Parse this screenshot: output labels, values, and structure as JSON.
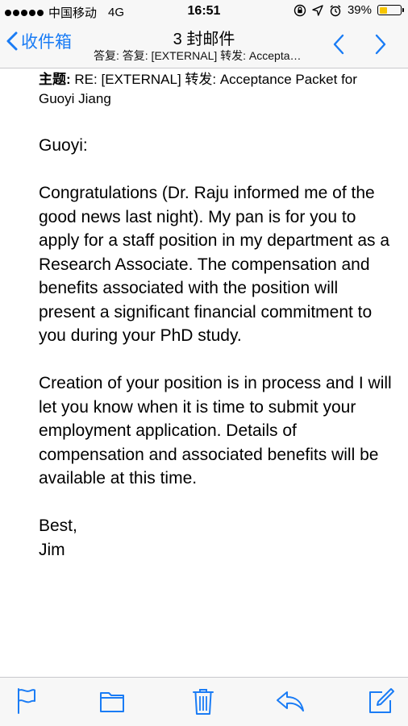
{
  "status_bar": {
    "carrier": "中国移动",
    "network": "4G",
    "time": "16:51",
    "battery_percent": "39%",
    "battery_level": 0.39,
    "colors": {
      "battery": "#f7c500"
    },
    "icons": [
      "signal-dots-icon",
      "rotation-lock-icon",
      "location-arrow-icon",
      "alarm-clock-icon",
      "battery-icon"
    ]
  },
  "nav": {
    "back_label": "收件箱",
    "title": "3 封邮件",
    "subtitle": "答复: 答复: [EXTERNAL] 转发: Accepta…",
    "accent_color": "#1a7cf5",
    "icons": [
      "chevron-left-icon",
      "chevron-up-icon",
      "chevron-down-icon"
    ]
  },
  "email": {
    "subject_label": "主题:",
    "subject_text": "RE: [EXTERNAL] 转发: Acceptance Packet for Guoyi Jiang",
    "greeting": "Guoyi:",
    "paragraph1": "Congratulations (Dr. Raju informed me of the good news last night).  My pan is for you to apply for a staff position in my department as a Research Associate.  The compensation and benefits associated with the position will present a significant financial commitment to you during your PhD study.",
    "paragraph2": "Creation of your position is in process and I will let you know when it is time to submit your employment application.  Details of compensation and associated benefits will be available at this time.",
    "closing": "Best,",
    "signature": "Jim"
  },
  "toolbar": {
    "icons": [
      "flag-icon",
      "folder-icon",
      "trash-icon",
      "reply-icon",
      "compose-icon"
    ]
  }
}
